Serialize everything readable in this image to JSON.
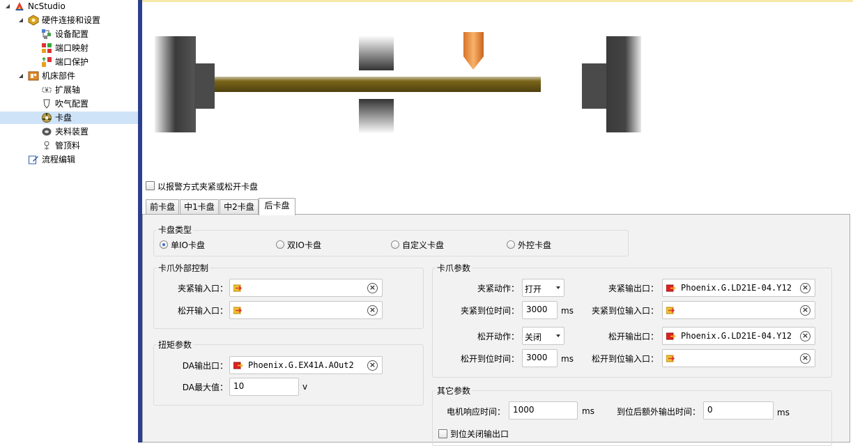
{
  "tree": {
    "root": "NcStudio",
    "hardware": "硬件连接和设置",
    "device_config": "设备配置",
    "port_map": "端口映射",
    "port_protect": "端口保护",
    "machine_parts": "机床部件",
    "ext_axis": "扩展轴",
    "blow_config": "吹气配置",
    "chuck": "卡盘",
    "clamp_device": "夹料装置",
    "pipe_top": "管顶料",
    "flow_edit": "流程编辑"
  },
  "alarm_checkbox_label": "以报警方式夹紧或松开卡盘",
  "tabs": [
    "前卡盘",
    "中1卡盘",
    "中2卡盘",
    "后卡盘"
  ],
  "active_tab": "后卡盘",
  "chuck_type": {
    "title": "卡盘类型",
    "options": [
      "单IO卡盘",
      "双IO卡盘",
      "自定义卡盘",
      "外控卡盘"
    ],
    "selected": "单IO卡盘"
  },
  "jaw_external": {
    "title": "卡爪外部控制",
    "clamp_input_label": "夹紧输入口：",
    "clamp_input_value": "",
    "release_input_label": "松开输入口：",
    "release_input_value": ""
  },
  "torque": {
    "title": "扭矩参数",
    "da_output_label": "DA输出口：",
    "da_output_value": "Phoenix.G.EX41A.AOut2",
    "da_max_label": "DA最大值：",
    "da_max_value": "10",
    "da_max_unit": "v"
  },
  "jaw_params": {
    "title": "卡爪参数",
    "clamp_action_label": "夹紧动作：",
    "clamp_action_value": "打开",
    "clamp_time_label": "夹紧到位时间：",
    "clamp_time_value": "3000",
    "clamp_time_unit": "ms",
    "release_action_label": "松开动作：",
    "release_action_value": "关闭",
    "release_time_label": "松开到位时间：",
    "release_time_value": "3000",
    "release_time_unit": "ms",
    "clamp_output_label": "夹紧输出口：",
    "clamp_output_value": "Phoenix.G.LD21E-04.Y12",
    "clamp_done_input_label": "夹紧到位输入口：",
    "clamp_done_input_value": "",
    "release_output_label": "松开输出口：",
    "release_output_value": "Phoenix.G.LD21E-04.Y12",
    "release_done_input_label": "松开到位输入口：",
    "release_done_input_value": ""
  },
  "other": {
    "title": "其它参数",
    "motor_resp_label": "电机响应时间：",
    "motor_resp_value": "1000",
    "motor_resp_unit": "ms",
    "extra_out_label": "到位后额外输出时间：",
    "extra_out_value": "0",
    "extra_out_unit": "ms",
    "close_output_label": "到位关闭输出口"
  },
  "icons": {
    "clear": "clear-circle-icon",
    "input_pin": "input-port-icon",
    "output_pin": "output-port-icon"
  },
  "colors": {
    "splitter": "#2a3f8f",
    "panel_bg": "#f2f2f2",
    "radio_dot": "#3c70c8",
    "shaft": "#6e5a14",
    "cutter": "#e88a3a"
  }
}
